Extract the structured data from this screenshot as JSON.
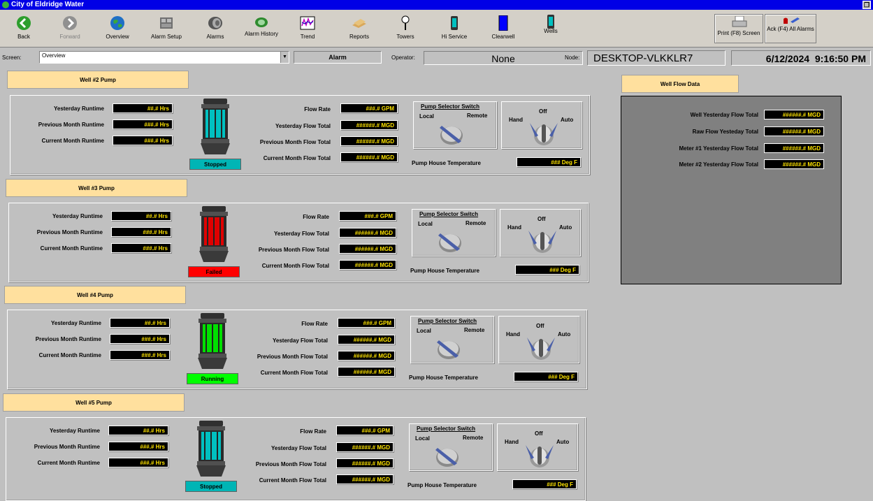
{
  "window": {
    "title": "City of Eldridge Water"
  },
  "toolbar": {
    "back": "Back",
    "forward": "Forward",
    "overview": "Overview",
    "alarm_setup": "Alarm Setup",
    "alarms": "Alarms",
    "alarm_history": "Alarm History",
    "trend": "Trend",
    "reports": "Reports",
    "towers": "Towers",
    "hi_service": "Hi Service",
    "clearwell": "Clearwell",
    "wells": "Wells",
    "print": "Print (F8) Screen",
    "ack": "Ack (F4) All Alarms"
  },
  "screenbar": {
    "screen_label": "Screen:",
    "screen_value": "Overview",
    "alarm_label": "Alarm",
    "operator_label": "Operator:",
    "operator_value": "None",
    "node_label": "Node:",
    "node_value": "DESKTOP-VLKKLR7",
    "datetime": "6/12/2024  9:16:50 PM"
  },
  "labels": {
    "yesterday_runtime": "Yesterday Runtime",
    "prev_month_runtime": "Previous Month Runtime",
    "curr_month_runtime": "Current Month Runtime",
    "flow_rate": "Flow Rate",
    "yesterday_flow": "Yesterday Flow Total",
    "prev_month_flow": "Previous Month Flow Total",
    "curr_month_flow": "Current Month Flow Total",
    "selector_title": "Pump Selector Switch",
    "local": "Local",
    "remote": "Remote",
    "hand": "Hand",
    "off": "Off",
    "auto": "Auto",
    "house_temp": "Pump House Temperature"
  },
  "values": {
    "hrs_small": "##.# Hrs",
    "hrs": "###.# Hrs",
    "gpm": "###.# GPM",
    "mgd": "######.# MGD",
    "degf": "### Deg F"
  },
  "wells": [
    {
      "title": "Well #2 Pump",
      "status": "Stopped",
      "status_color": "#00b5b5",
      "pump_color": "#00c0c0",
      "yrt": "##.# Hrs",
      "gpm": "###.# GPM"
    },
    {
      "title": "Well #3 Pump",
      "status": "Failed",
      "status_color": "#ff0000",
      "pump_color": "#e00000",
      "yrt": "##.# Hrs",
      "gpm": "###.# GPM"
    },
    {
      "title": "Well #4 Pump",
      "status": "Running",
      "status_color": "#00ff00",
      "pump_color": "#00e000",
      "yrt": "##.# Hrs",
      "gpm": "###.# GPM"
    },
    {
      "title": "Well #5 Pump",
      "status": "Stopped",
      "status_color": "#00b5b5",
      "pump_color": "#00c0c0",
      "yrt": "##.# Hrs",
      "gpm": "###.# GPM"
    }
  ],
  "flowdata": {
    "title": "Well Flow Data",
    "rows": [
      {
        "label": "Well Yesterday Flow Total",
        "value": "######.# MGD"
      },
      {
        "label": "Raw Flow Yesteday Total",
        "value": "######.# MGD"
      },
      {
        "label": "Meter #1 Yesterday Flow Total",
        "value": "######.# MGD"
      },
      {
        "label": "Meter #2 Yesterday Flow Total",
        "value": "######.# MGD"
      }
    ]
  }
}
